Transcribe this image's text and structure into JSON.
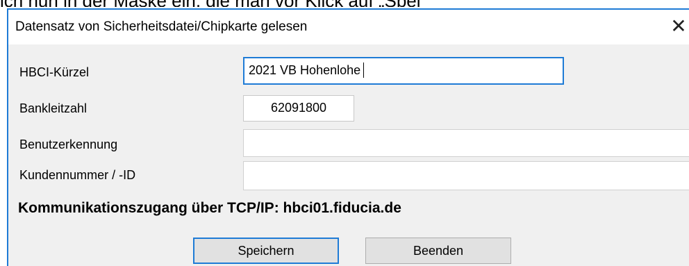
{
  "background": {
    "partial_text": "ich nun in der Maske ein, die man vor Klick auf „Spei"
  },
  "dialog": {
    "title": "Datensatz von Sicherheitsdatei/Chipkarte gelesen",
    "close_glyph": "✕"
  },
  "form": {
    "hbci_label": "HBCI-Kürzel",
    "hbci_value": "2021 VB Hohenlohe",
    "blz_label": "Bankleitzahl",
    "blz_value": "62091800",
    "user_label": "Benutzerkennung",
    "user_value": "",
    "customer_label": "Kundennummer / -ID",
    "customer_value": ""
  },
  "info_text": "Kommunikationszugang über TCP/IP: hbci01.fiducia.de",
  "buttons": {
    "save_label": "Speichern",
    "exit_label": "Beenden"
  },
  "colors": {
    "accent": "#1e7bd6",
    "dialog_bg": "#f0f0f0",
    "button_bg": "#e1e1e1"
  }
}
